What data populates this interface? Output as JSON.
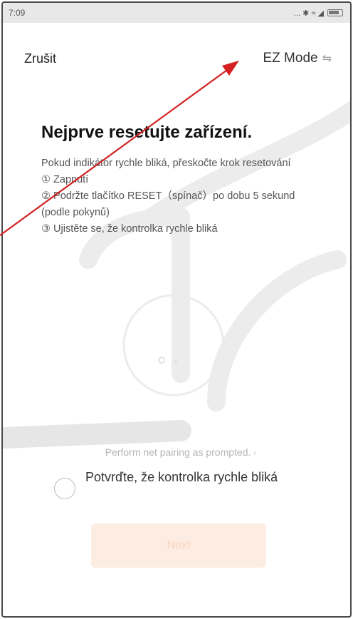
{
  "status_bar": {
    "time": "7:09",
    "signal_text": "... ✱ ≈ ◢"
  },
  "header": {
    "cancel_label": "Zrušit",
    "mode_label": "EZ Mode",
    "mode_icon": "swap-icon"
  },
  "content": {
    "title": "Nejprve resetujte zařízení.",
    "instructions": [
      "Pokud indikátor rychle bliká, přeskočte krok resetování",
      "① Zapnutí",
      "② Podržte tlačítko RESET（spínač）po dobu 5 sekund (podle pokynů)",
      "③ Ujistěte se, že kontrolka rychle bliká"
    ],
    "pair_hint": "Perform net pairing as prompted.",
    "confirm_label": "Potvrďte, že kontrolka rychle bliká",
    "next_label": "Next"
  },
  "colors": {
    "annotation_arrow": "#d42020",
    "button_bg": "#fdece2",
    "button_text": "#fbd3bd"
  }
}
